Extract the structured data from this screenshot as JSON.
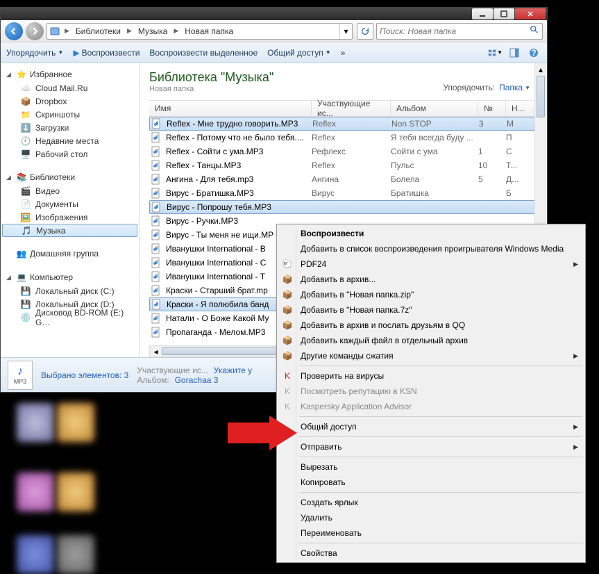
{
  "titlebar": {
    "min": "_",
    "max": "☐",
    "close": "✕"
  },
  "breadcrumb": {
    "seg1": "Библиотеки",
    "seg2": "Музыка",
    "seg3": "Новая папка"
  },
  "search": {
    "placeholder": "Поиск: Новая папка"
  },
  "toolbar": {
    "organize": "Упорядочить",
    "play": "Воспроизвести",
    "play_sel": "Воспроизвести выделенное",
    "share": "Общий доступ",
    "more": "»"
  },
  "sidebar": {
    "favorites": {
      "label": "Избранное",
      "items": [
        {
          "label": "Cloud Mail.Ru",
          "icon": "cloud"
        },
        {
          "label": "Dropbox",
          "icon": "dropbox"
        },
        {
          "label": "Скриншоты",
          "icon": "folder"
        },
        {
          "label": "Загрузки",
          "icon": "download"
        },
        {
          "label": "Недавние места",
          "icon": "recent"
        },
        {
          "label": "Рабочий стол",
          "icon": "desktop"
        }
      ]
    },
    "libraries": {
      "label": "Библиотеки",
      "items": [
        {
          "label": "Видео",
          "icon": "video"
        },
        {
          "label": "Документы",
          "icon": "doc"
        },
        {
          "label": "Изображения",
          "icon": "image"
        },
        {
          "label": "Музыка",
          "icon": "music",
          "sel": true
        }
      ]
    },
    "homegroup": {
      "label": "Домашняя группа"
    },
    "computer": {
      "label": "Компьютер",
      "items": [
        {
          "label": "Локальный диск (C:)",
          "icon": "drive"
        },
        {
          "label": "Локальный диск (D:)",
          "icon": "drive"
        },
        {
          "label": "Дисковод BD-ROM (E:) G…",
          "icon": "optical"
        }
      ]
    }
  },
  "library": {
    "title": "Библиотека \"Музыка\"",
    "subtitle": "Новая папка",
    "arrange_label": "Упорядочить:",
    "arrange_value": "Папка"
  },
  "columns": {
    "c1": "Имя",
    "c2": "Участвующие ис...",
    "c3": "Альбом",
    "c4": "№",
    "c5": "Н..."
  },
  "files": [
    {
      "name": "Reflex - Мне трудно говорить.MP3",
      "artist": "Reflex",
      "album": "Non STOP",
      "num": "3",
      "extra": "М",
      "sel": true
    },
    {
      "name": "Reflex - Потому что не было тебя....",
      "artist": "Reflex",
      "album": "Я тебя всегда буду ...",
      "num": "",
      "extra": "П"
    },
    {
      "name": "Reflex - Сойти с ума.MP3",
      "artist": "Рефлекс",
      "album": "Сойти с ума",
      "num": "1",
      "extra": "С"
    },
    {
      "name": "Reflex - Танцы.MP3",
      "artist": "Reflex",
      "album": "Пульс",
      "num": "10",
      "extra": "Т..."
    },
    {
      "name": "Ангина - Для тебя.mp3",
      "artist": "Ангина",
      "album": "Болела",
      "num": "5",
      "extra": "Д..."
    },
    {
      "name": "Вирус - Братишка.MP3",
      "artist": "Вирус",
      "album": "Братишка",
      "num": "",
      "extra": "Б"
    },
    {
      "name": "Вирус - Попрошу тебя.MP3",
      "artist": "",
      "album": "",
      "num": "",
      "extra": "",
      "sel": true
    },
    {
      "name": "Вирус - Ручки.MP3",
      "artist": "",
      "album": "",
      "num": "",
      "extra": ""
    },
    {
      "name": "Вирус - Ты меня не ищи.MP",
      "artist": "",
      "album": "",
      "num": "",
      "extra": ""
    },
    {
      "name": "Иванушки International - В",
      "artist": "",
      "album": "",
      "num": "",
      "extra": ""
    },
    {
      "name": "Иванушки International - С",
      "artist": "",
      "album": "",
      "num": "",
      "extra": ""
    },
    {
      "name": "Иванушки International - Т",
      "artist": "",
      "album": "",
      "num": "",
      "extra": ""
    },
    {
      "name": "Краски - Старший брат.mp",
      "artist": "",
      "album": "",
      "num": "",
      "extra": ""
    },
    {
      "name": "Краски - Я полюбила банд",
      "artist": "",
      "album": "",
      "num": "",
      "extra": "",
      "sel": true
    },
    {
      "name": "Натали - О Боже Какой Му",
      "artist": "",
      "album": "",
      "num": "",
      "extra": ""
    },
    {
      "name": "Пропаганда - Мелом.MP3",
      "artist": "",
      "album": "",
      "num": "",
      "extra": ""
    }
  ],
  "status": {
    "thumb_ext": "MP3",
    "selected": "Выбрано элементов: 3",
    "artists_label": "Участвующие ис...",
    "artists_value": "Укажите у",
    "album_label": "Альбом:",
    "album_value": "Gorachaa 3"
  },
  "context": {
    "play": "Воспроизвести",
    "add_playlist": "Добавить в список воспроизведения проигрывателя Windows Media",
    "pdf24": "PDF24",
    "add_archive": "Добавить в архив...",
    "add_zip": "Добавить в \"Новая папка.zip\"",
    "add_7z": "Добавить в \"Новая папка.7z\"",
    "add_qq": "Добавить в архив и послать друзьям в QQ",
    "add_each": "Добавить каждый файл в отдельный архив",
    "other_compress": "Другие команды сжатия",
    "scan_virus": "Проверить на вирусы",
    "ksn": "Посмотреть репутацию в KSN",
    "kaa": "Kaspersky Application Advisor",
    "share": "Общий доступ",
    "send": "Отправить",
    "cut": "Вырезать",
    "copy": "Копировать",
    "shortcut": "Создать ярлык",
    "delete": "Удалить",
    "rename": "Переименовать",
    "props": "Свойства"
  }
}
